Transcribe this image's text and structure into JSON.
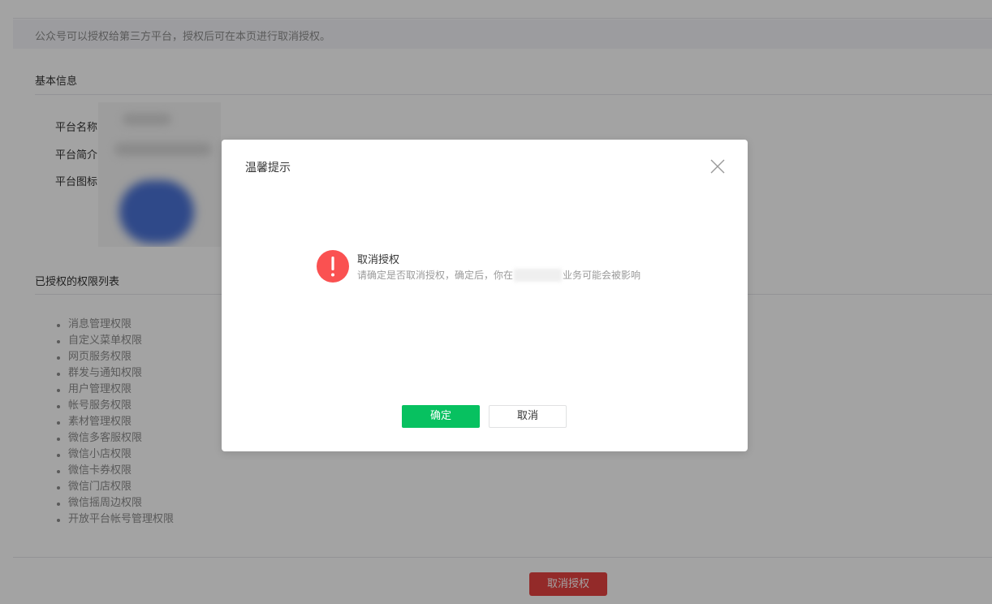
{
  "colors": {
    "accent_green": "#07c160",
    "danger_red": "#e64340",
    "warning_icon": "#fa5151",
    "mask": "rgba(0,0,0,0.36)"
  },
  "page": {
    "notice": "公众号可以授权给第三方平台，授权后可在本页进行取消授权。",
    "basic_info": {
      "title": "基本信息",
      "labels": {
        "name": "平台名称",
        "intro": "平台简介",
        "icon": "平台图标"
      }
    },
    "permissions": {
      "title": "已授权的权限列表",
      "items": [
        "消息管理权限",
        "自定义菜单权限",
        "网页服务权限",
        "群发与通知权限",
        "用户管理权限",
        "帐号服务权限",
        "素材管理权限",
        "微信多客服权限",
        "微信小店权限",
        "微信卡券权限",
        "微信门店权限",
        "微信摇周边权限",
        "开放平台帐号管理权限"
      ]
    },
    "revoke_button": "取消授权"
  },
  "dialog": {
    "title": "温馨提示",
    "close_icon": "close-icon",
    "warning_icon": "exclamation-circle-icon",
    "message_title": "取消授权",
    "message_prefix": "请确定是否取消授权，确定后，你在",
    "message_suffix": "业务可能会被影响",
    "confirm_label": "确定",
    "cancel_label": "取消"
  }
}
